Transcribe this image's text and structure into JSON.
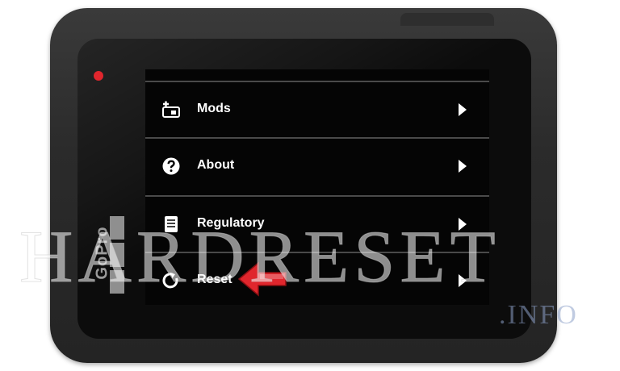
{
  "device": {
    "brand": "GoPro"
  },
  "menu": {
    "items": [
      {
        "label": "Mods",
        "icon": "mods-icon"
      },
      {
        "label": "About",
        "icon": "question-icon"
      },
      {
        "label": "Regulatory",
        "icon": "document-icon"
      },
      {
        "label": "Reset",
        "icon": "reset-icon"
      }
    ]
  },
  "watermark": {
    "main": "HARDRESET",
    "suffix": ".INFO"
  },
  "colors": {
    "record": "#e0262d",
    "arrow": "#e0262d",
    "text": "#ffffff"
  }
}
